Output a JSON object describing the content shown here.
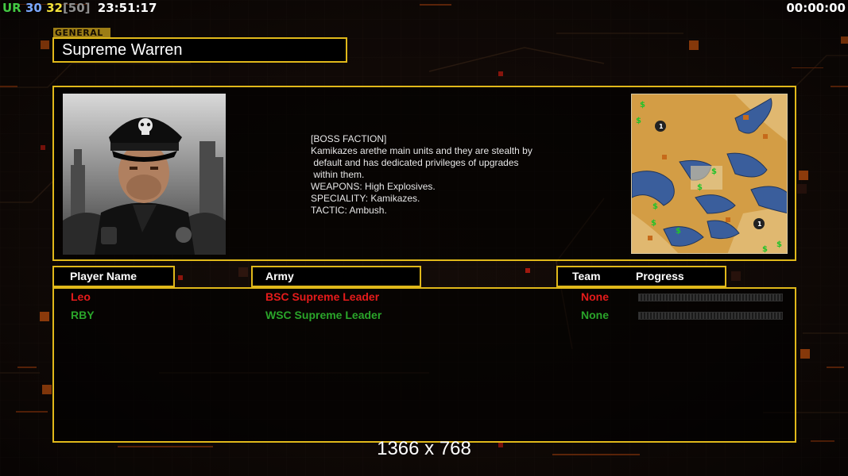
{
  "hud": {
    "ur_label": "UR",
    "fps": "30",
    "ping": "32",
    "bracket_value": "[50]",
    "clock": "23:51:17",
    "timer": "00:00:00"
  },
  "general": {
    "tag": "GENERAL",
    "name": "Supreme Warren"
  },
  "description": {
    "lines": [
      "[BOSS FACTION]",
      "Kamikazes arethe main units and they are stealth by",
      " default and has dedicated privileges of upgrades",
      " within them.",
      "WEAPONS: High Explosives.",
      "SPECIALITY: Kamikazes.",
      "TACTIC: Ambush."
    ]
  },
  "portrait": {
    "badge_text": "APURADA W.T",
    "icon": "skull-cap-officer-portrait"
  },
  "minimap": {
    "icon": "desert-map-preview",
    "markers": [
      "$",
      "$",
      "$",
      "$",
      "$",
      "$",
      "$",
      "$",
      "$",
      "1",
      "1"
    ]
  },
  "columns": {
    "player": "Player Name",
    "army": "Army",
    "team": "Team",
    "progress": "Progress"
  },
  "players": [
    {
      "name": "Leo",
      "army": "BSC Supreme Leader",
      "team": "None",
      "color": "#e51b1b"
    },
    {
      "name": "RBY",
      "army": "WSC Supreme Leader",
      "team": "None",
      "color": "#2aa52a"
    }
  ],
  "resolution": "1366 x 768",
  "colors": {
    "accent": "#e0b81a",
    "glow": "#ff7a1a"
  }
}
